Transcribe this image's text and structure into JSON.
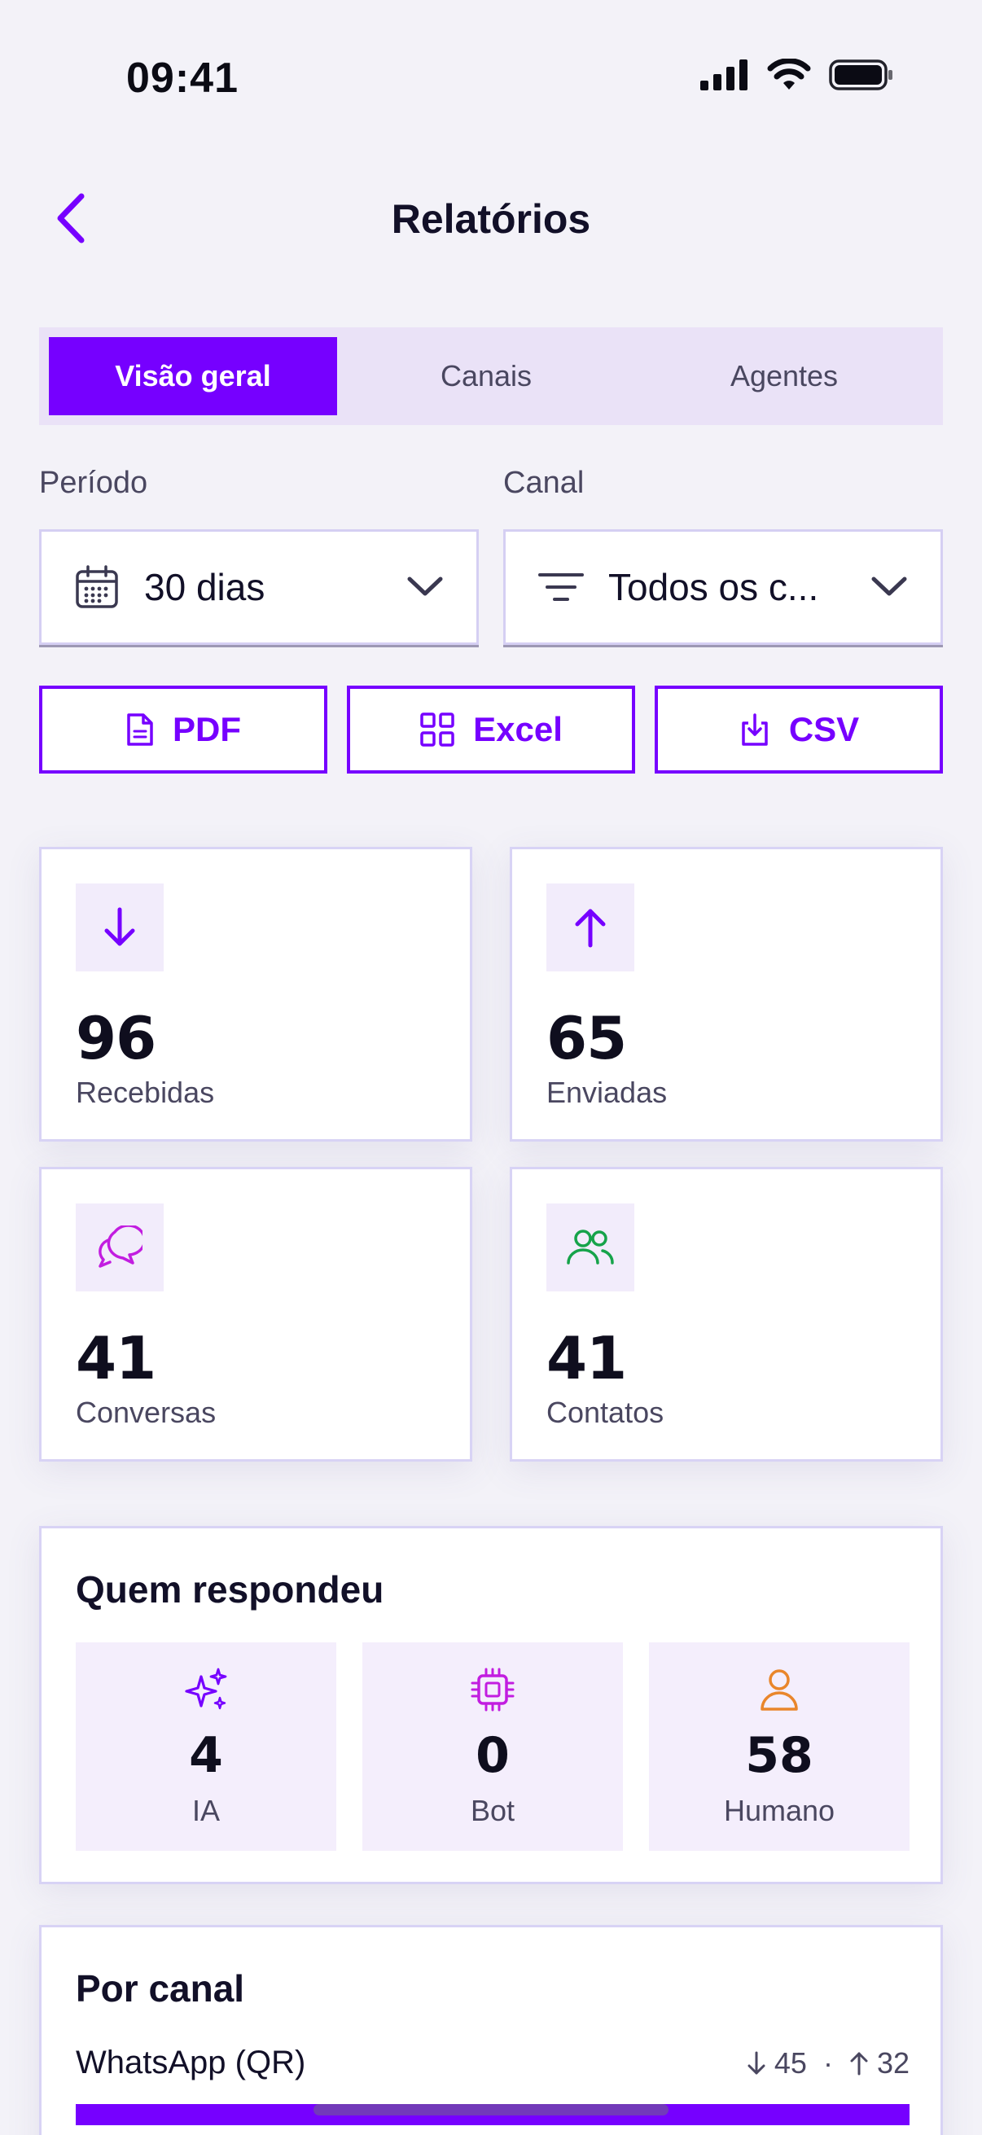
{
  "status_bar": {
    "time": "09:41"
  },
  "header": {
    "title": "Relatórios"
  },
  "tabs": [
    {
      "label": "Visão geral",
      "active": true
    },
    {
      "label": "Canais",
      "active": false
    },
    {
      "label": "Agentes",
      "active": false
    }
  ],
  "filters": {
    "period": {
      "label": "Período",
      "value": "30 dias"
    },
    "channel": {
      "label": "Canal",
      "value": "Todos os c..."
    }
  },
  "export": {
    "pdf": "PDF",
    "excel": "Excel",
    "csv": "CSV"
  },
  "stats": {
    "received": {
      "value": "96",
      "label": "Recebidas"
    },
    "sent": {
      "value": "65",
      "label": "Enviadas"
    },
    "conversations": {
      "value": "41",
      "label": "Conversas"
    },
    "contacts": {
      "value": "41",
      "label": "Contatos"
    }
  },
  "responders": {
    "title": "Quem respondeu",
    "ai": {
      "value": "4",
      "label": "IA"
    },
    "bot": {
      "value": "0",
      "label": "Bot"
    },
    "human": {
      "value": "58",
      "label": "Humano"
    }
  },
  "by_channel": {
    "title": "Por canal",
    "items": [
      {
        "name": "WhatsApp (QR)",
        "received": "45",
        "sent": "32",
        "separator": "·",
        "share": 1.0
      }
    ]
  },
  "colors": {
    "accent": "#7600FF",
    "accent_soft": "#EAE2F7",
    "icon_pink": "#C21DE0",
    "icon_green": "#16A34A",
    "icon_orange": "#E9862B"
  },
  "icons": {
    "received": "arrow-down-icon",
    "sent": "arrow-up-icon",
    "conversations": "chat-bubbles-icon",
    "contacts": "users-icon",
    "ai": "sparkles-icon",
    "bot": "chip-icon",
    "human": "user-icon"
  }
}
